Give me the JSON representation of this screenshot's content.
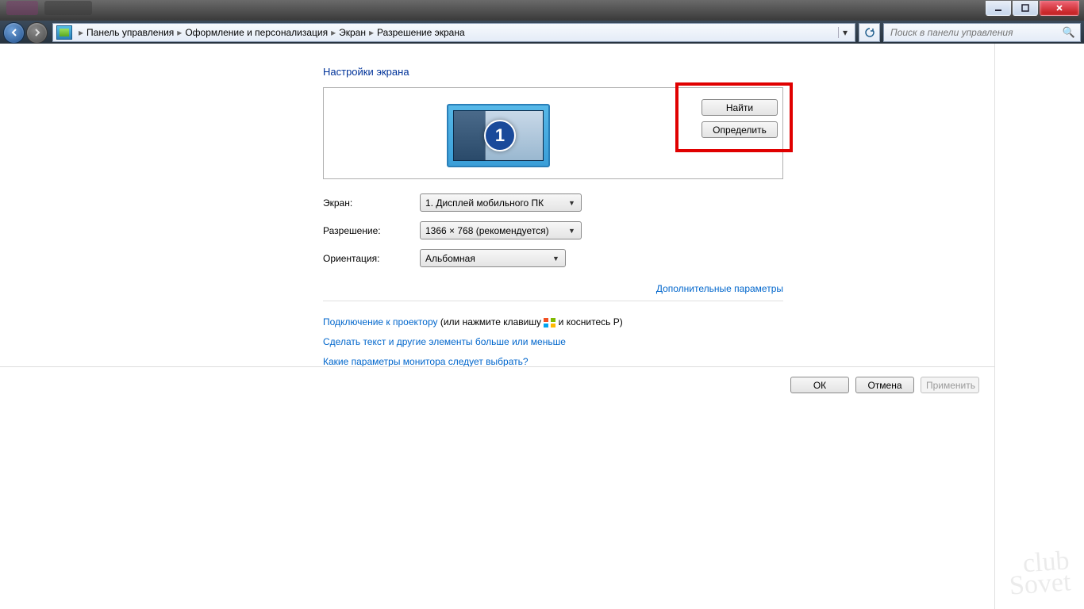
{
  "breadcrumb": {
    "root": "Панель управления",
    "l1": "Оформление и персонализация",
    "l2": "Экран",
    "l3": "Разрешение экрана"
  },
  "search": {
    "placeholder": "Поиск в панели управления"
  },
  "page": {
    "title": "Настройки экрана",
    "monitor_number": "1",
    "find_btn": "Найти",
    "detect_btn": "Определить"
  },
  "form": {
    "screen_label": "Экран:",
    "screen_value": "1. Дисплей мобильного ПК",
    "resolution_label": "Разрешение:",
    "resolution_value": "1366 × 768 (рекомендуется)",
    "orientation_label": "Ориентация:",
    "orientation_value": "Альбомная"
  },
  "links": {
    "advanced": "Дополнительные параметры",
    "projector_link": "Подключение к проектору",
    "projector_tail_a": " (или нажмите клавишу ",
    "projector_tail_b": " и коснитесь P)",
    "text_size": "Сделать текст и другие элементы больше или меньше",
    "which": "Какие параметры монитора следует выбрать?"
  },
  "footer": {
    "ok": "ОК",
    "cancel": "Отмена",
    "apply": "Применить"
  },
  "watermark": {
    "l1": "club",
    "l2": "Sovet"
  }
}
